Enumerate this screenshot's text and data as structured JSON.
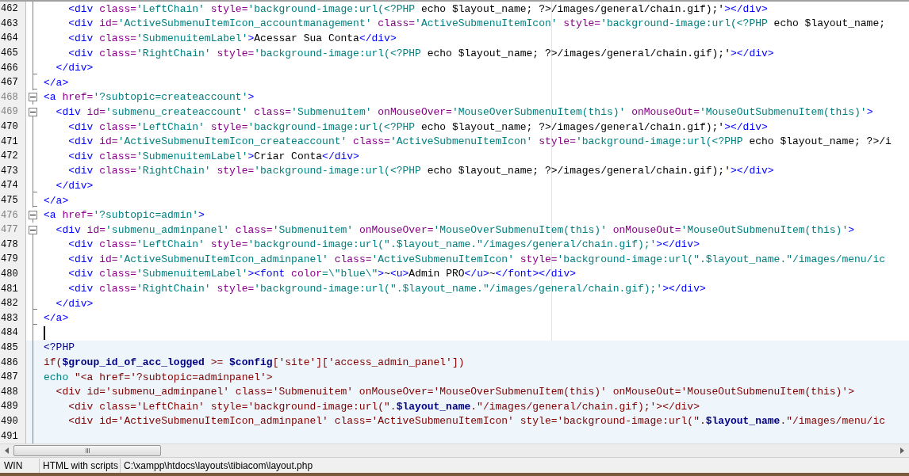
{
  "lines": [
    {
      "number": "462",
      "kind": "line",
      "php": false,
      "cursor": false,
      "tokens": [
        {
          "kind": "tag",
          "text": "    <div"
        },
        {
          "kind": "attr",
          "text": " class="
        },
        {
          "kind": "str",
          "text": "'LeftChain'"
        },
        {
          "kind": "attr",
          "text": " style="
        },
        {
          "kind": "str",
          "text": "'background-image:url(<?PHP"
        },
        {
          "kind": "text",
          "text": " echo $layout_name; ?>/images/general/chain.gif);'"
        },
        {
          "kind": "tag",
          "text": "></div>"
        }
      ]
    },
    {
      "number": "463",
      "kind": "line",
      "php": false,
      "cursor": false,
      "tokens": [
        {
          "kind": "tag",
          "text": "    <div"
        },
        {
          "kind": "attr",
          "text": " id="
        },
        {
          "kind": "str",
          "text": "'ActiveSubmenuItemIcon_accountmanagement'"
        },
        {
          "kind": "attr",
          "text": " class="
        },
        {
          "kind": "str",
          "text": "'ActiveSubmenuItemIcon'"
        },
        {
          "kind": "attr",
          "text": " style="
        },
        {
          "kind": "str",
          "text": "'background-image:url(<?PHP"
        },
        {
          "kind": "text",
          "text": " echo $layout_name;"
        }
      ]
    },
    {
      "number": "464",
      "kind": "line",
      "php": false,
      "cursor": false,
      "tokens": [
        {
          "kind": "tag",
          "text": "    <div"
        },
        {
          "kind": "attr",
          "text": " class="
        },
        {
          "kind": "str",
          "text": "'SubmenuitemLabel'"
        },
        {
          "kind": "tag",
          "text": ">"
        },
        {
          "kind": "text",
          "text": "Acessar Sua Conta"
        },
        {
          "kind": "tag",
          "text": "</div>"
        }
      ]
    },
    {
      "number": "465",
      "kind": "line",
      "php": false,
      "cursor": false,
      "tokens": [
        {
          "kind": "tag",
          "text": "    <div"
        },
        {
          "kind": "attr",
          "text": " class="
        },
        {
          "kind": "str",
          "text": "'RightChain'"
        },
        {
          "kind": "attr",
          "text": " style="
        },
        {
          "kind": "str",
          "text": "'background-image:url(<?PHP"
        },
        {
          "kind": "text",
          "text": " echo $layout_name; ?>/images/general/chain.gif);'"
        },
        {
          "kind": "tag",
          "text": "></div>"
        }
      ]
    },
    {
      "number": "466",
      "kind": "end",
      "php": false,
      "cursor": false,
      "tokens": [
        {
          "kind": "tag",
          "text": "  </div>"
        }
      ]
    },
    {
      "number": "467",
      "kind": "end",
      "php": false,
      "cursor": false,
      "tokens": [
        {
          "kind": "tag",
          "text": "</a>"
        }
      ]
    },
    {
      "number": "468",
      "kind": "start",
      "php": false,
      "cursor": false,
      "tokens": [
        {
          "kind": "tag",
          "text": "<a"
        },
        {
          "kind": "attr",
          "text": " href="
        },
        {
          "kind": "str",
          "text": "'?subtopic=createaccount'"
        },
        {
          "kind": "tag",
          "text": ">"
        }
      ]
    },
    {
      "number": "469",
      "kind": "start",
      "php": false,
      "cursor": false,
      "tokens": [
        {
          "kind": "tag",
          "text": "  <div"
        },
        {
          "kind": "attr",
          "text": " id="
        },
        {
          "kind": "str",
          "text": "'submenu_createaccount'"
        },
        {
          "kind": "attr",
          "text": " class="
        },
        {
          "kind": "str",
          "text": "'Submenuitem'"
        },
        {
          "kind": "attr",
          "text": " onMouseOver="
        },
        {
          "kind": "str",
          "text": "'MouseOverSubmenuItem(this)'"
        },
        {
          "kind": "attr",
          "text": " onMouseOut="
        },
        {
          "kind": "str",
          "text": "'MouseOutSubmenuItem(this)'"
        },
        {
          "kind": "tag",
          "text": ">"
        }
      ]
    },
    {
      "number": "470",
      "kind": "line",
      "php": false,
      "cursor": false,
      "tokens": [
        {
          "kind": "tag",
          "text": "    <div"
        },
        {
          "kind": "attr",
          "text": " class="
        },
        {
          "kind": "str",
          "text": "'LeftChain'"
        },
        {
          "kind": "attr",
          "text": " style="
        },
        {
          "kind": "str",
          "text": "'background-image:url(<?PHP"
        },
        {
          "kind": "text",
          "text": " echo $layout_name; ?>/images/general/chain.gif);'"
        },
        {
          "kind": "tag",
          "text": "></div>"
        }
      ]
    },
    {
      "number": "471",
      "kind": "line",
      "php": false,
      "cursor": false,
      "tokens": [
        {
          "kind": "tag",
          "text": "    <div"
        },
        {
          "kind": "attr",
          "text": " id="
        },
        {
          "kind": "str",
          "text": "'ActiveSubmenuItemIcon_createaccount'"
        },
        {
          "kind": "attr",
          "text": " class="
        },
        {
          "kind": "str",
          "text": "'ActiveSubmenuItemIcon'"
        },
        {
          "kind": "attr",
          "text": " style="
        },
        {
          "kind": "str",
          "text": "'background-image:url(<?PHP"
        },
        {
          "kind": "text",
          "text": " echo $layout_name; ?>/i"
        }
      ]
    },
    {
      "number": "472",
      "kind": "line",
      "php": false,
      "cursor": false,
      "tokens": [
        {
          "kind": "tag",
          "text": "    <div"
        },
        {
          "kind": "attr",
          "text": " class="
        },
        {
          "kind": "str",
          "text": "'SubmenuitemLabel'"
        },
        {
          "kind": "tag",
          "text": ">"
        },
        {
          "kind": "text",
          "text": "Criar Conta"
        },
        {
          "kind": "tag",
          "text": "</div>"
        }
      ]
    },
    {
      "number": "473",
      "kind": "line",
      "php": false,
      "cursor": false,
      "tokens": [
        {
          "kind": "tag",
          "text": "    <div"
        },
        {
          "kind": "attr",
          "text": " class="
        },
        {
          "kind": "str",
          "text": "'RightChain'"
        },
        {
          "kind": "attr",
          "text": " style="
        },
        {
          "kind": "str",
          "text": "'background-image:url(<?PHP"
        },
        {
          "kind": "text",
          "text": " echo $layout_name; ?>/images/general/chain.gif);'"
        },
        {
          "kind": "tag",
          "text": "></div>"
        }
      ]
    },
    {
      "number": "474",
      "kind": "end",
      "php": false,
      "cursor": false,
      "tokens": [
        {
          "kind": "tag",
          "text": "  </div>"
        }
      ]
    },
    {
      "number": "475",
      "kind": "end",
      "php": false,
      "cursor": false,
      "tokens": [
        {
          "kind": "tag",
          "text": "</a>"
        }
      ]
    },
    {
      "number": "476",
      "kind": "start",
      "php": false,
      "cursor": false,
      "tokens": [
        {
          "kind": "tag",
          "text": "<a"
        },
        {
          "kind": "attr",
          "text": " href="
        },
        {
          "kind": "str",
          "text": "'?subtopic=admin'"
        },
        {
          "kind": "tag",
          "text": ">"
        }
      ]
    },
    {
      "number": "477",
      "kind": "start",
      "php": false,
      "cursor": false,
      "tokens": [
        {
          "kind": "tag",
          "text": "  <div"
        },
        {
          "kind": "attr",
          "text": " id="
        },
        {
          "kind": "str",
          "text": "'submenu_adminpanel'"
        },
        {
          "kind": "attr",
          "text": " class="
        },
        {
          "kind": "str",
          "text": "'Submenuitem'"
        },
        {
          "kind": "attr",
          "text": " onMouseOver="
        },
        {
          "kind": "str",
          "text": "'MouseOverSubmenuItem(this)'"
        },
        {
          "kind": "attr",
          "text": " onMouseOut="
        },
        {
          "kind": "str",
          "text": "'MouseOutSubmenuItem(this)'"
        },
        {
          "kind": "tag",
          "text": ">"
        }
      ]
    },
    {
      "number": "478",
      "kind": "line",
      "php": false,
      "cursor": false,
      "tokens": [
        {
          "kind": "tag",
          "text": "    <div"
        },
        {
          "kind": "attr",
          "text": " class="
        },
        {
          "kind": "str",
          "text": "'LeftChain'"
        },
        {
          "kind": "attr",
          "text": " style="
        },
        {
          "kind": "str",
          "text": "'background-image:url(\".$layout_name.\"/images/general/chain.gif);'"
        },
        {
          "kind": "tag",
          "text": "></div>"
        }
      ]
    },
    {
      "number": "479",
      "kind": "line",
      "php": false,
      "cursor": false,
      "tokens": [
        {
          "kind": "tag",
          "text": "    <div"
        },
        {
          "kind": "attr",
          "text": " id="
        },
        {
          "kind": "str",
          "text": "'ActiveSubmenuItemIcon_adminpanel'"
        },
        {
          "kind": "attr",
          "text": " class="
        },
        {
          "kind": "str",
          "text": "'ActiveSubmenuItemIcon'"
        },
        {
          "kind": "attr",
          "text": " style="
        },
        {
          "kind": "str",
          "text": "'background-image:url(\".$layout_name.\"/images/menu/ic"
        }
      ]
    },
    {
      "number": "480",
      "kind": "line",
      "php": false,
      "cursor": false,
      "tokens": [
        {
          "kind": "tag",
          "text": "    <div"
        },
        {
          "kind": "attr",
          "text": " class="
        },
        {
          "kind": "str",
          "text": "'SubmenuitemLabel'"
        },
        {
          "kind": "tag",
          "text": "><font"
        },
        {
          "kind": "attr",
          "text": " color"
        },
        {
          "kind": "str",
          "text": "=\\\"blue\\\""
        },
        {
          "kind": "tag",
          "text": ">"
        },
        {
          "kind": "text",
          "text": "~"
        },
        {
          "kind": "tag",
          "text": "<u>"
        },
        {
          "kind": "text",
          "text": "Admin PRO"
        },
        {
          "kind": "tag",
          "text": "</u>"
        },
        {
          "kind": "text",
          "text": "~"
        },
        {
          "kind": "tag",
          "text": "</font></div>"
        }
      ]
    },
    {
      "number": "481",
      "kind": "line",
      "php": false,
      "cursor": false,
      "tokens": [
        {
          "kind": "tag",
          "text": "    <div"
        },
        {
          "kind": "attr",
          "text": " class="
        },
        {
          "kind": "str",
          "text": "'RightChain'"
        },
        {
          "kind": "attr",
          "text": " style="
        },
        {
          "kind": "str",
          "text": "'background-image:url(\".$layout_name.\"/images/general/chain.gif);'"
        },
        {
          "kind": "tag",
          "text": "></div>"
        }
      ]
    },
    {
      "number": "482",
      "kind": "end",
      "php": false,
      "cursor": false,
      "tokens": [
        {
          "kind": "tag",
          "text": "  </div>"
        }
      ]
    },
    {
      "number": "483",
      "kind": "end",
      "php": false,
      "cursor": false,
      "tokens": [
        {
          "kind": "tag",
          "text": "</a>"
        }
      ]
    },
    {
      "number": "484",
      "kind": "line",
      "php": false,
      "cursor": true
    },
    {
      "number": "485",
      "kind": "line",
      "php": true,
      "cursor": false,
      "tokens": [
        {
          "kind": "phpdelim",
          "text": "<?PHP"
        }
      ]
    },
    {
      "number": "486",
      "kind": "line",
      "php": true,
      "cursor": false,
      "tokens": [
        {
          "kind": "php",
          "text": "if("
        },
        {
          "kind": "phpvar",
          "text": "$group_id_of_acc_logged"
        },
        {
          "kind": "php",
          "text": " >= "
        },
        {
          "kind": "phpvar",
          "text": "$config"
        },
        {
          "kind": "php",
          "text": "['site']['access_admin_panel'])"
        }
      ]
    },
    {
      "number": "487",
      "kind": "line",
      "php": true,
      "cursor": false,
      "tokens": [
        {
          "kind": "phpkw",
          "text": "echo"
        },
        {
          "kind": "php",
          "text": " \"<a href='?subtopic=adminpanel'>"
        }
      ]
    },
    {
      "number": "488",
      "kind": "line",
      "php": true,
      "cursor": false,
      "tokens": [
        {
          "kind": "php",
          "text": "  <div id='submenu_adminpanel' class='Submenuitem' onMouseOver='MouseOverSubmenuItem(this)' onMouseOut='MouseOutSubmenuItem(this)'>"
        }
      ]
    },
    {
      "number": "489",
      "kind": "line",
      "php": true,
      "cursor": false,
      "tokens": [
        {
          "kind": "php",
          "text": "    <div class='LeftChain' style='background-image:url(\"."
        },
        {
          "kind": "phpvar",
          "text": "$layout_name"
        },
        {
          "kind": "php",
          "text": ".\"/images/general/chain.gif);'></div>"
        }
      ]
    },
    {
      "number": "490",
      "kind": "line",
      "php": true,
      "cursor": false,
      "tokens": [
        {
          "kind": "php",
          "text": "    <div id='ActiveSubmenuItemIcon_adminpanel' class='ActiveSubmenuItemIcon' style='background-image:url(\"."
        },
        {
          "kind": "phpvar",
          "text": "$layout_name"
        },
        {
          "kind": "php",
          "text": ".\"/images/menu/ic"
        }
      ]
    },
    {
      "number": "491",
      "kind": "line",
      "php": true,
      "cursor": false
    }
  ],
  "status_bar": {
    "encoding": "WIN",
    "language": "HTML with scripts",
    "path": "C:\\xampp\\htdocs\\layouts\\tibiacom\\layout.php"
  }
}
